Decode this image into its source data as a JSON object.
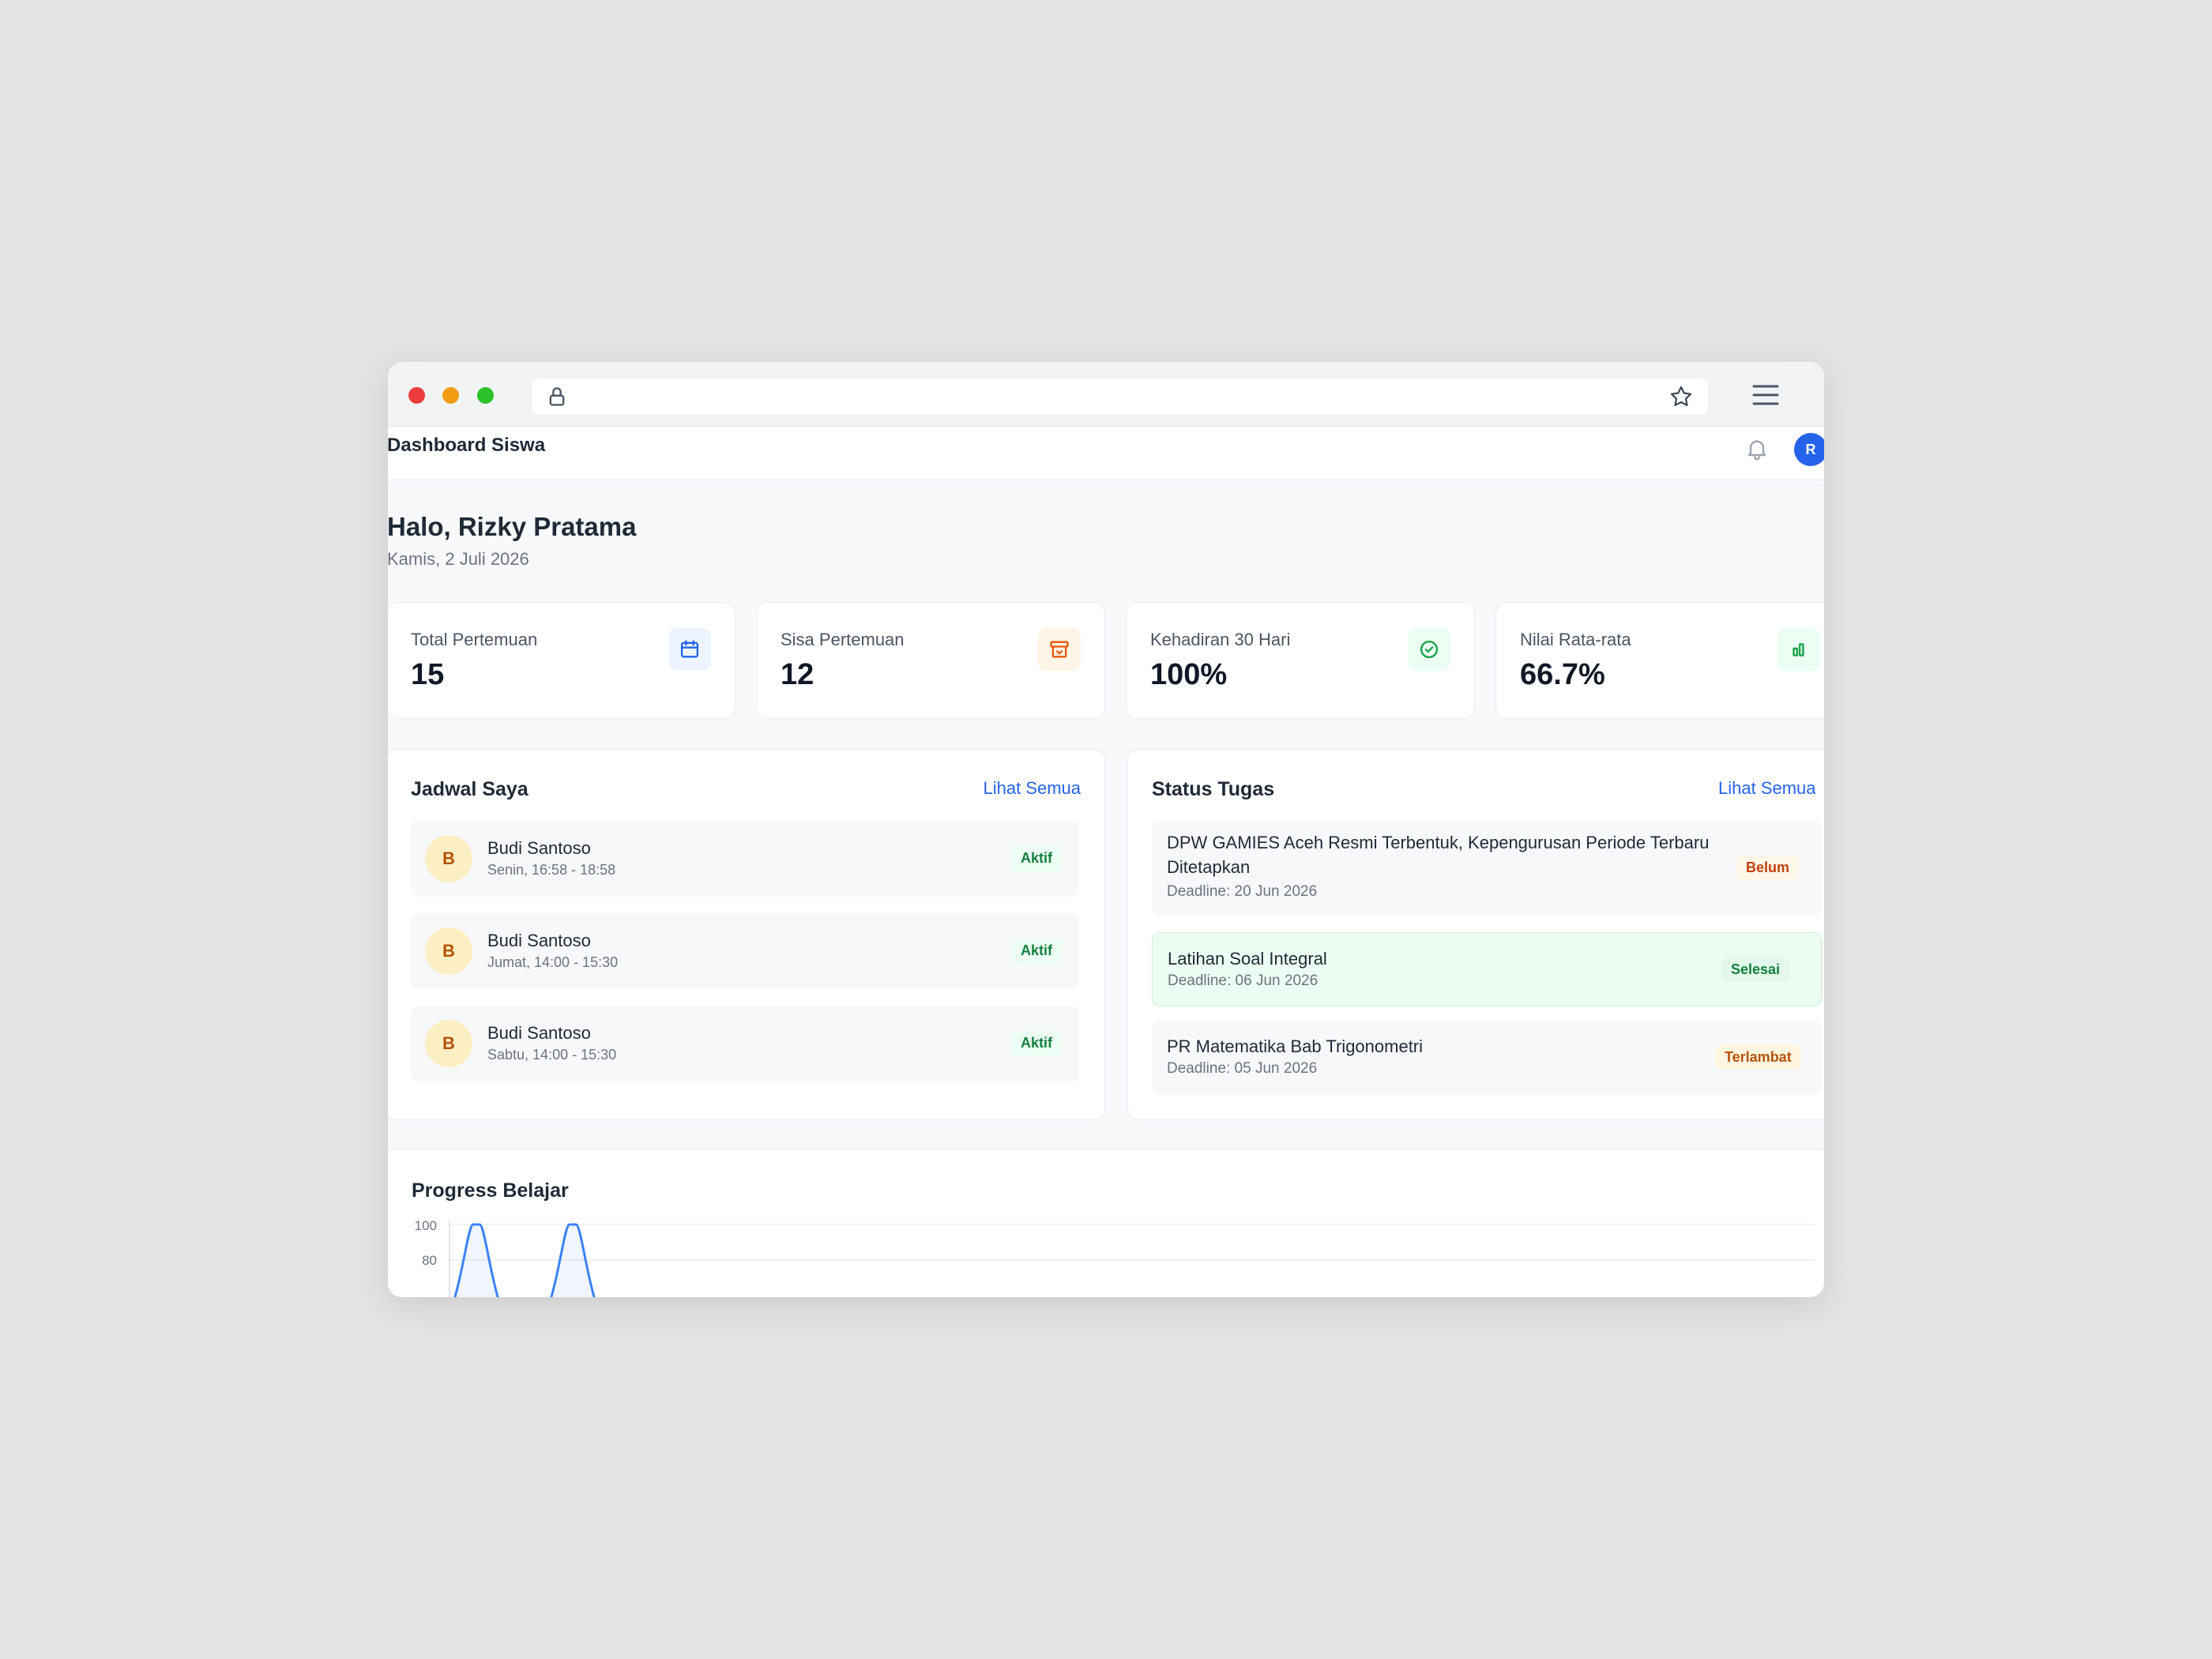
{
  "app": {
    "title": "Dashboard Siswa",
    "avatar_initial": "R"
  },
  "greeting": {
    "title": "Halo, Rizky Pratama",
    "date": "Kamis, 2 Juli 2026"
  },
  "stats": [
    {
      "label": "Total Pertemuan",
      "value": "15",
      "icon": "calendar-icon",
      "color": "#2563eb"
    },
    {
      "label": "Sisa Pertemuan",
      "value": "12",
      "icon": "archive-icon",
      "color": "#ea580c"
    },
    {
      "label": "Kehadiran 30 Hari",
      "value": "100%",
      "icon": "check-circle-icon",
      "color": "#16a34a"
    },
    {
      "label": "Nilai Rata-rata",
      "value": "66.7%",
      "icon": "bar-chart-icon",
      "color": "#16a34a"
    }
  ],
  "schedule": {
    "title": "Jadwal Saya",
    "link": "Lihat Semua",
    "items": [
      {
        "initial": "B",
        "name": "Budi Santoso",
        "time": "Senin, 16:58 - 18:58",
        "status": "Aktif"
      },
      {
        "initial": "B",
        "name": "Budi Santoso",
        "time": "Jumat, 14:00 - 15:30",
        "status": "Aktif"
      },
      {
        "initial": "B",
        "name": "Budi Santoso",
        "time": "Sabtu, 14:00 - 15:30",
        "status": "Aktif"
      }
    ]
  },
  "tasks": {
    "title": "Status Tugas",
    "link": "Lihat Semua",
    "items": [
      {
        "title_line1": "DPW GAMIES Aceh Resmi Terbentuk, Kepengurusan Periode Terbaru",
        "title_line2": "Ditetapkan",
        "deadline": "Deadline: 20 Jun 2026",
        "status": "Belum"
      },
      {
        "title_line1": "Latihan Soal Integral",
        "deadline": "Deadline: 06 Jun 2026",
        "status": "Selesai"
      },
      {
        "title_line1": "PR Matematika Bab Trigonometri",
        "deadline": "Deadline: 05 Jun 2026",
        "status": "Terlambat"
      }
    ]
  },
  "progress": {
    "title": "Progress Belajar"
  },
  "chart_data": {
    "type": "area",
    "y_ticks": [
      "100",
      "80"
    ],
    "series": [
      {
        "values": [
          100,
          100
        ]
      }
    ],
    "color": "#3b82f6"
  }
}
